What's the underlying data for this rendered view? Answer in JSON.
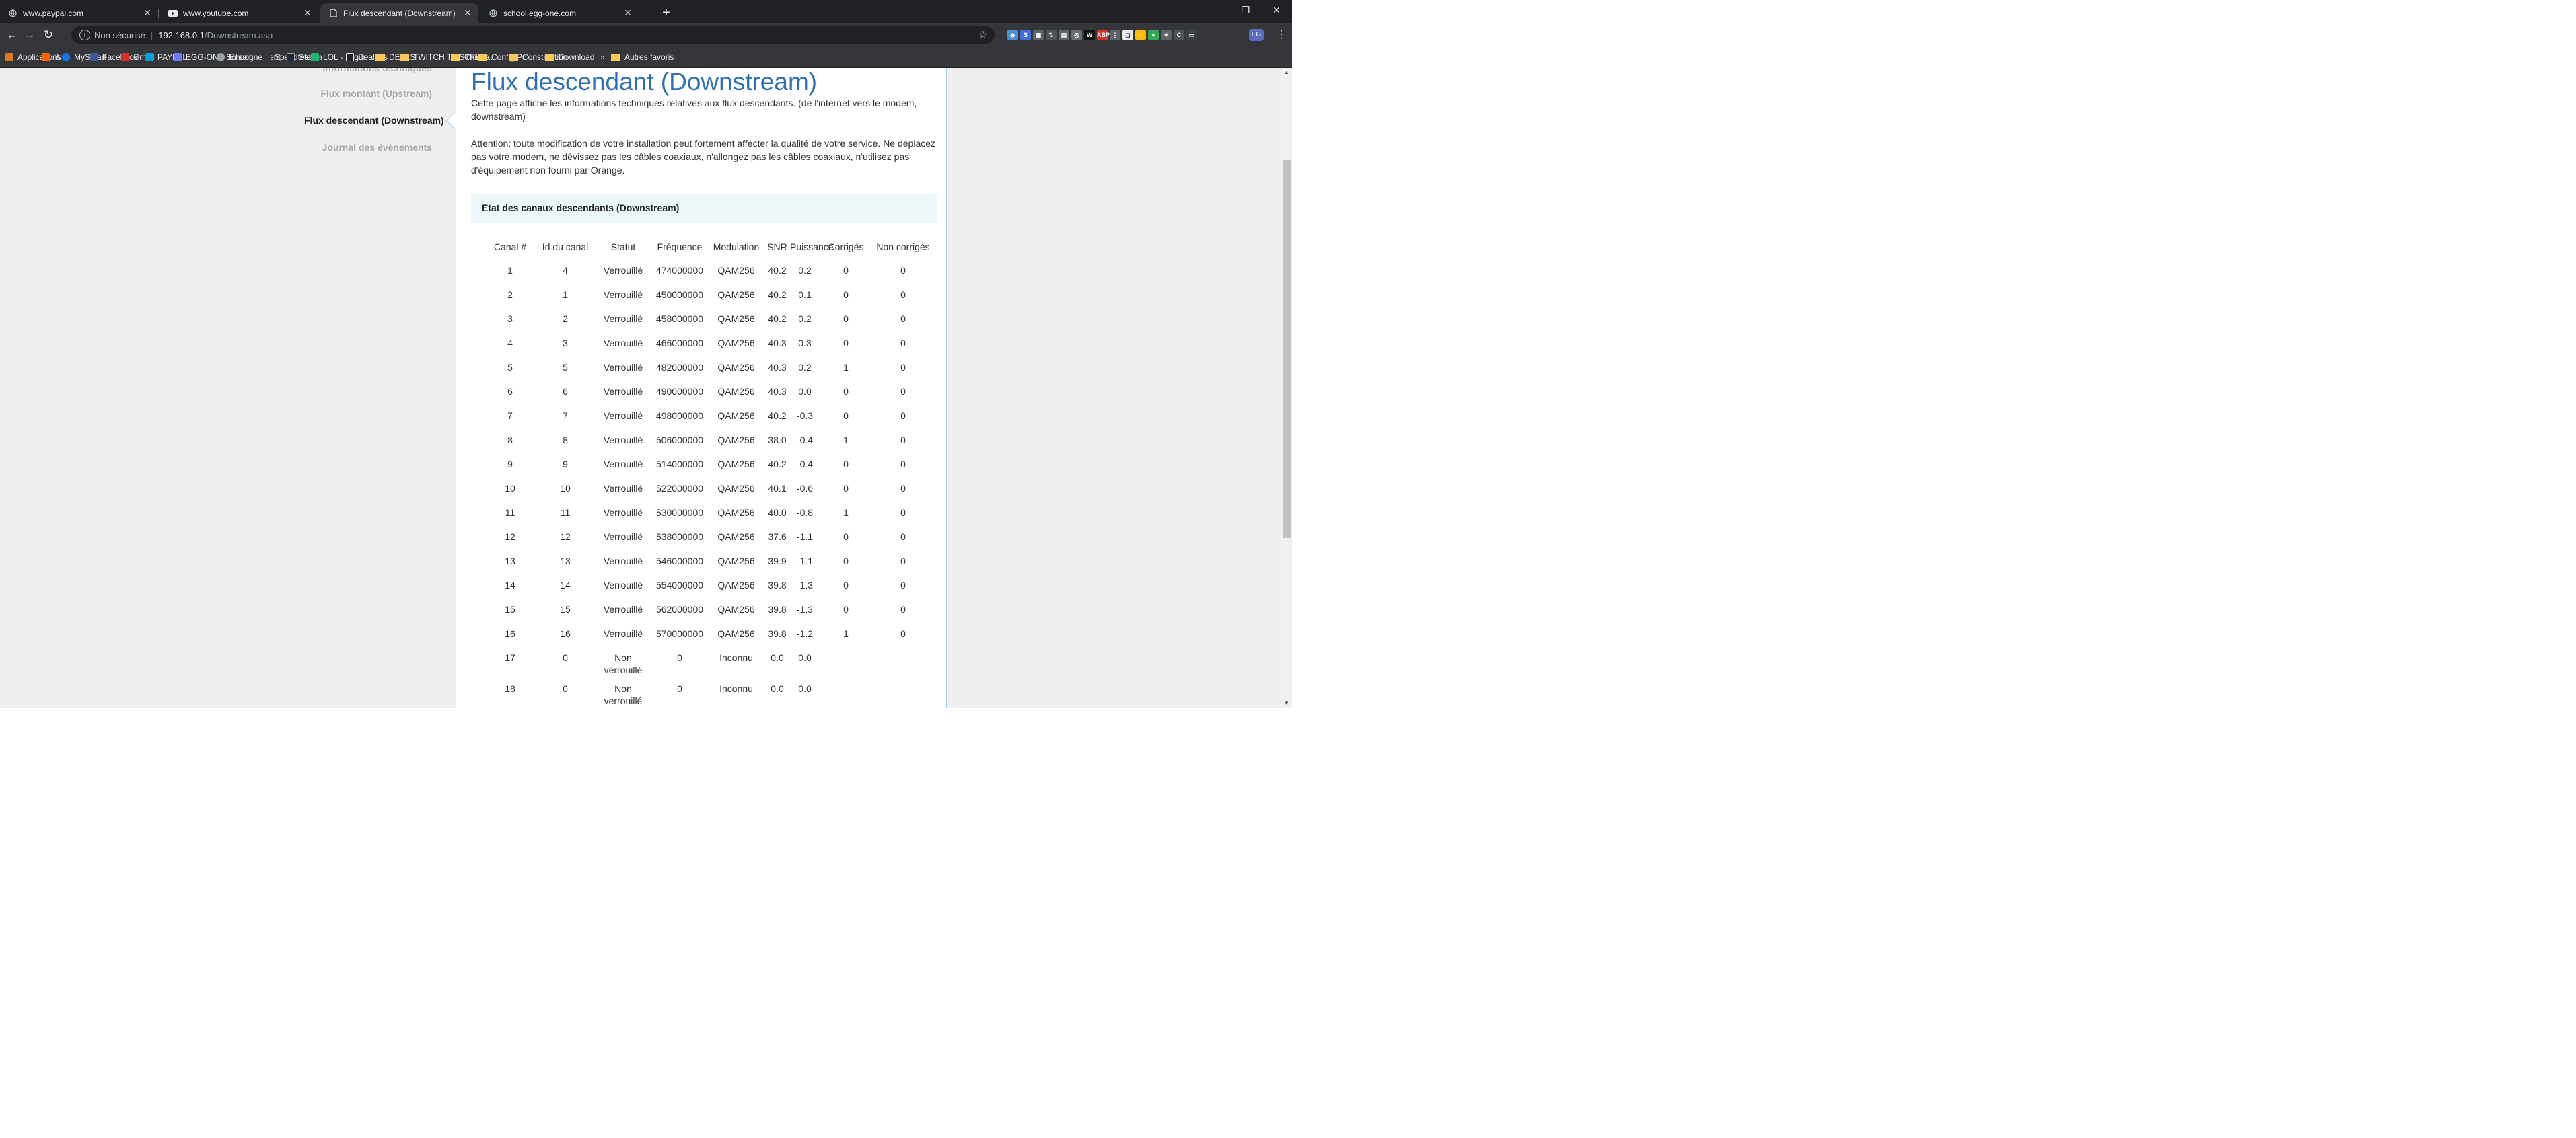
{
  "browser": {
    "tabs": [
      {
        "title": "www.paypal.com",
        "active": false
      },
      {
        "title": "www.youtube.com",
        "active": false
      },
      {
        "title": "Flux descendant (Downstream)",
        "active": true
      },
      {
        "title": "school.egg-one.com",
        "active": false
      }
    ],
    "address": {
      "security_label": "Non sécurisé",
      "host": "192.168.0.1",
      "path": "/Downstream.asp"
    },
    "bookmarks": [
      {
        "label": "Applications",
        "color": "#e07a1f"
      },
      {
        "label": "ING",
        "color": "#ff6200"
      },
      {
        "label": "MySmart",
        "color": "#1a73e8"
      },
      {
        "label": "Facebook",
        "color": "#3b5998"
      },
      {
        "label": "Gmail",
        "color": "#d93025"
      },
      {
        "label": "PAYPAL",
        "color": "#009cde"
      },
      {
        "label": "EGG-ONE School",
        "color": "#6b7cff"
      },
      {
        "label": "Enseignement",
        "color": "#9aa0a6"
      },
      {
        "label": "Speedtest",
        "color": "#35363a"
      },
      {
        "label": "Steam",
        "color": "#1b2838"
      },
      {
        "label": "LOL - Imgur",
        "color": "#1bb76e"
      },
      {
        "label": "Dealabs",
        "color": "#202124"
      },
      {
        "label": "DEALS",
        "color": "#f8ca55"
      },
      {
        "label": "TWITCH TV STREA...",
        "color": "#f8ca55"
      },
      {
        "label": "Chicha",
        "color": "#f8ca55"
      },
      {
        "label": "Config Pc",
        "color": "#f8ca55"
      },
      {
        "label": "Construction",
        "color": "#f8ca55"
      },
      {
        "label": "Download",
        "color": "#f8ca55"
      }
    ],
    "overflow_label": "»",
    "other_bookmarks": "Autres favoris",
    "profile_initials": "EG"
  },
  "sidebar": {
    "items": [
      {
        "label": "Informations techniques",
        "active": false
      },
      {
        "label": "Flux montant (Upstream)",
        "active": false
      },
      {
        "label": "Flux descendant (Downstream)",
        "active": true
      },
      {
        "label": "Journal des évènements",
        "active": false
      }
    ]
  },
  "main": {
    "title": "Flux descendant (Downstream)",
    "intro": "Cette page affiche les informations techniques relatives aux flux descendants. (de l'internet vers le modem, downstream)",
    "warning": "Attention: toute modification de votre installation peut fortement affecter la qualité de votre service. Ne déplacez pas votre modem, ne dévissez pas les câbles coaxiaux, n'allongez pas les câbles coaxiaux, n'utilisez pas d'équipement non fourni par Orange.",
    "section_title": "Etat des canaux descendants (Downstream)",
    "table": {
      "headers": [
        "Canal #",
        "Id du canal",
        "Statut",
        "Fréquence",
        "Modulation",
        "SNR",
        "Puissance",
        "Corrigés",
        "Non corrigés"
      ],
      "rows": [
        [
          "1",
          "4",
          "Verrouillé",
          "474000000",
          "QAM256",
          "40.2",
          "0.2",
          "0",
          "0"
        ],
        [
          "2",
          "1",
          "Verrouillé",
          "450000000",
          "QAM256",
          "40.2",
          "0.1",
          "0",
          "0"
        ],
        [
          "3",
          "2",
          "Verrouillé",
          "458000000",
          "QAM256",
          "40.2",
          "0.2",
          "0",
          "0"
        ],
        [
          "4",
          "3",
          "Verrouillé",
          "466000000",
          "QAM256",
          "40.3",
          "0.3",
          "0",
          "0"
        ],
        [
          "5",
          "5",
          "Verrouillé",
          "482000000",
          "QAM256",
          "40.3",
          "0.2",
          "1",
          "0"
        ],
        [
          "6",
          "6",
          "Verrouillé",
          "490000000",
          "QAM256",
          "40.3",
          "0.0",
          "0",
          "0"
        ],
        [
          "7",
          "7",
          "Verrouillé",
          "498000000",
          "QAM256",
          "40.2",
          "-0.3",
          "0",
          "0"
        ],
        [
          "8",
          "8",
          "Verrouillé",
          "506000000",
          "QAM256",
          "38.0",
          "-0.4",
          "1",
          "0"
        ],
        [
          "9",
          "9",
          "Verrouillé",
          "514000000",
          "QAM256",
          "40.2",
          "-0.4",
          "0",
          "0"
        ],
        [
          "10",
          "10",
          "Verrouillé",
          "522000000",
          "QAM256",
          "40.1",
          "-0.6",
          "0",
          "0"
        ],
        [
          "11",
          "11",
          "Verrouillé",
          "530000000",
          "QAM256",
          "40.0",
          "-0.8",
          "1",
          "0"
        ],
        [
          "12",
          "12",
          "Verrouillé",
          "538000000",
          "QAM256",
          "37.6",
          "-1.1",
          "0",
          "0"
        ],
        [
          "13",
          "13",
          "Verrouillé",
          "546000000",
          "QAM256",
          "39.9",
          "-1.1",
          "0",
          "0"
        ],
        [
          "14",
          "14",
          "Verrouillé",
          "554000000",
          "QAM256",
          "39.8",
          "-1.3",
          "0",
          "0"
        ],
        [
          "15",
          "15",
          "Verrouillé",
          "562000000",
          "QAM256",
          "39.8",
          "-1.3",
          "0",
          "0"
        ],
        [
          "16",
          "16",
          "Verrouillé",
          "570000000",
          "QAM256",
          "39.8",
          "-1.2",
          "1",
          "0"
        ],
        [
          "17",
          "0",
          "Non verrouillé",
          "0",
          "Inconnu",
          "0.0",
          "0.0",
          "",
          ""
        ],
        [
          "18",
          "0",
          "Non verrouillé",
          "0",
          "Inconnu",
          "0.0",
          "0.0",
          "",
          ""
        ]
      ]
    }
  }
}
